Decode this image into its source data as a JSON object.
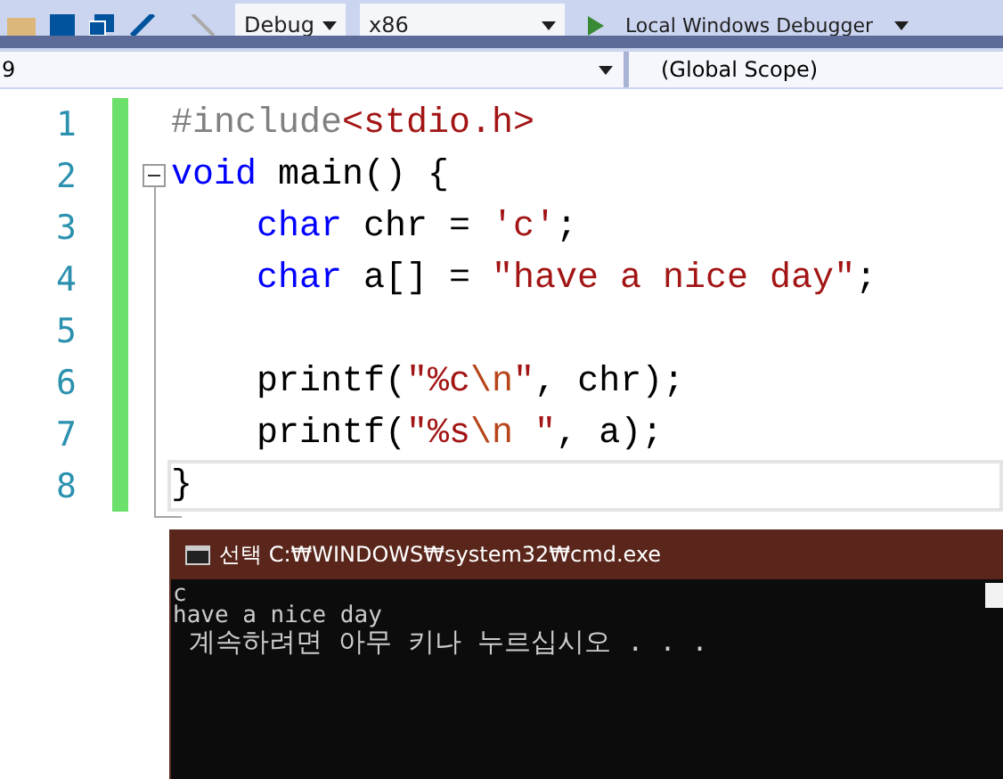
{
  "toolbar": {
    "configuration": "Debug",
    "platform": "x86",
    "debugger": "Local Windows Debugger"
  },
  "navigation_bar": {
    "project": "9",
    "scope": "(Global Scope)"
  },
  "editor": {
    "lines": [
      {
        "number": "1",
        "current": false,
        "tokens": [
          {
            "kind": "preprocessor",
            "text": "#include"
          },
          {
            "kind": "string",
            "text": "<stdio.h>"
          }
        ]
      },
      {
        "number": "2",
        "current": false,
        "tokens": [
          {
            "kind": "keyword",
            "text": "void"
          },
          {
            "kind": "plain",
            "text": " main() {"
          }
        ]
      },
      {
        "number": "3",
        "current": false,
        "indented": true,
        "tokens": [
          {
            "kind": "keyword",
            "text": "char"
          },
          {
            "kind": "plain",
            "text": " chr = "
          },
          {
            "kind": "string",
            "text": "'c'"
          },
          {
            "kind": "plain",
            "text": ";"
          }
        ]
      },
      {
        "number": "4",
        "current": false,
        "indented": true,
        "tokens": [
          {
            "kind": "keyword",
            "text": "char"
          },
          {
            "kind": "plain",
            "text": " a[] = "
          },
          {
            "kind": "string",
            "text": "\"have a nice day\""
          },
          {
            "kind": "plain",
            "text": ";"
          }
        ]
      },
      {
        "number": "5",
        "current": false
      },
      {
        "number": "6",
        "current": false,
        "indented": true,
        "tokens": [
          {
            "kind": "plain",
            "text": "printf("
          },
          {
            "kind": "string",
            "text": "\"%c"
          },
          {
            "kind": "escape",
            "text": "\\n"
          },
          {
            "kind": "string",
            "text": "\""
          },
          {
            "kind": "plain",
            "text": ", chr);"
          }
        ]
      },
      {
        "number": "7",
        "current": false,
        "indented": true,
        "tokens": [
          {
            "kind": "plain",
            "text": "printf("
          },
          {
            "kind": "string",
            "text": "\"%s"
          },
          {
            "kind": "escape",
            "text": "\\n"
          },
          {
            "kind": "string",
            "text": " \""
          },
          {
            "kind": "plain",
            "text": ", a);"
          }
        ]
      },
      {
        "number": "8",
        "current": true,
        "tokens": [
          {
            "kind": "plain",
            "text": "}"
          }
        ]
      }
    ]
  },
  "console": {
    "title_prefix": "선택",
    "title": "C:₩WINDOWS₩system32₩cmd.exe",
    "output": [
      "c",
      "have a nice day",
      " 계속하려면 아무 키나 누르십시오 . . ."
    ]
  }
}
